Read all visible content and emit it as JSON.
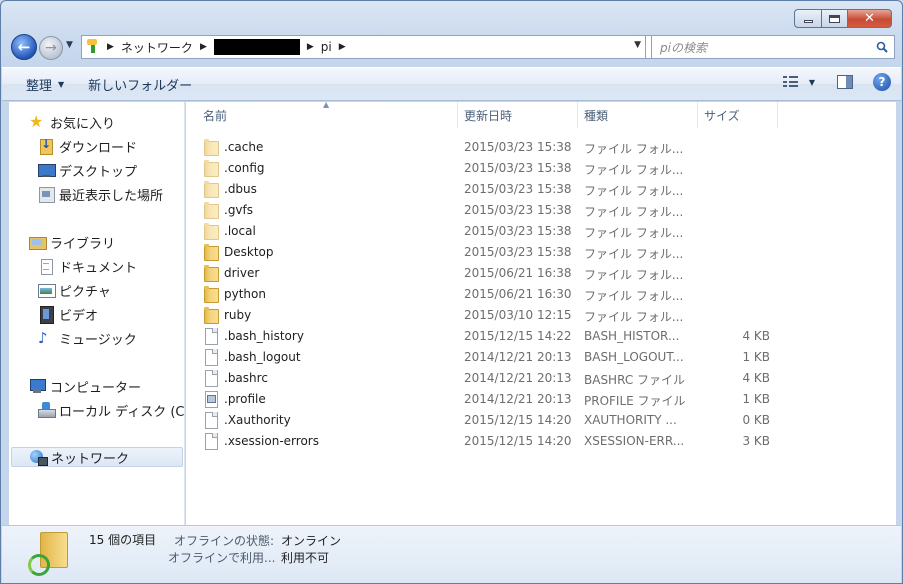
{
  "address": {
    "crumbs": [
      "ネットワーク",
      "pi"
    ],
    "search_placeholder": "piの検索"
  },
  "toolbar": {
    "organize_label": "整理",
    "new_folder_label": "新しいフォルダー"
  },
  "sidebar": {
    "favorites": "お気に入り",
    "downloads": "ダウンロード",
    "desktop": "デスクトップ",
    "recent": "最近表示した場所",
    "libraries": "ライブラリ",
    "documents": "ドキュメント",
    "pictures": "ピクチャ",
    "videos": "ビデオ",
    "music": "ミュージック",
    "computer": "コンピューター",
    "local_disk": "ローカル ディスク (C:",
    "network": "ネットワーク"
  },
  "columns": {
    "name": "名前",
    "date": "更新日時",
    "type": "種類",
    "size": "サイズ"
  },
  "files": [
    {
      "name": ".cache",
      "date": "2015/03/23 15:38",
      "type": "ファイル フォル...",
      "size": "",
      "icon": "folder-icon"
    },
    {
      "name": ".config",
      "date": "2015/03/23 15:38",
      "type": "ファイル フォル...",
      "size": "",
      "icon": "folder-icon"
    },
    {
      "name": ".dbus",
      "date": "2015/03/23 15:38",
      "type": "ファイル フォル...",
      "size": "",
      "icon": "folder-icon"
    },
    {
      "name": ".gvfs",
      "date": "2015/03/23 15:38",
      "type": "ファイル フォル...",
      "size": "",
      "icon": "folder-icon"
    },
    {
      "name": ".local",
      "date": "2015/03/23 15:38",
      "type": "ファイル フォル...",
      "size": "",
      "icon": "folder-icon"
    },
    {
      "name": "Desktop",
      "date": "2015/03/23 15:38",
      "type": "ファイル フォル...",
      "size": "",
      "icon": "folder-icon"
    },
    {
      "name": "driver",
      "date": "2015/06/21 16:38",
      "type": "ファイル フォル...",
      "size": "",
      "icon": "folder-icon"
    },
    {
      "name": "python",
      "date": "2015/06/21 16:30",
      "type": "ファイル フォル...",
      "size": "",
      "icon": "folder-icon"
    },
    {
      "name": "ruby",
      "date": "2015/03/10 12:15",
      "type": "ファイル フォル...",
      "size": "",
      "icon": "folder-icon"
    },
    {
      "name": ".bash_history",
      "date": "2015/12/15 14:22",
      "type": "BASH_HISTOR...",
      "size": "4 KB",
      "icon": "file-icon"
    },
    {
      "name": ".bash_logout",
      "date": "2014/12/21 20:13",
      "type": "BASH_LOGOUT...",
      "size": "1 KB",
      "icon": "file-icon"
    },
    {
      "name": ".bashrc",
      "date": "2014/12/21 20:13",
      "type": "BASHRC ファイル",
      "size": "4 KB",
      "icon": "file-icon"
    },
    {
      "name": ".profile",
      "date": "2014/12/21 20:13",
      "type": "PROFILE ファイル",
      "size": "1 KB",
      "icon": "cfg-icon"
    },
    {
      "name": ".Xauthority",
      "date": "2015/12/15 14:20",
      "type": "XAUTHORITY ...",
      "size": "0 KB",
      "icon": "file-icon"
    },
    {
      "name": ".xsession-errors",
      "date": "2015/12/15 14:20",
      "type": "XSESSION-ERR...",
      "size": "3 KB",
      "icon": "file-icon"
    }
  ],
  "status": {
    "count": "15 個の項目",
    "offline_label": "オフラインの状態:",
    "offline_value": "オンライン",
    "offline_use_label": "オフラインで利用...",
    "offline_use_value": "利用不可"
  }
}
